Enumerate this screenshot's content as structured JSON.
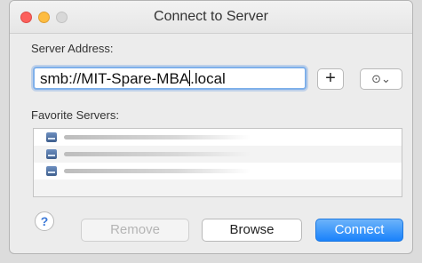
{
  "window": {
    "title": "Connect to Server"
  },
  "server": {
    "label": "Server Address:",
    "address_before_cursor": "smb://MIT-Spare-MBA",
    "address_after_cursor": ".local",
    "add_label": "+",
    "recent_label": "⊙⌄"
  },
  "favorites": {
    "label": "Favorite Servers:",
    "rows": [
      {},
      {},
      {}
    ]
  },
  "actions": {
    "help_label": "?",
    "remove_label": "Remove",
    "browse_label": "Browse",
    "connect_label": "Connect"
  }
}
